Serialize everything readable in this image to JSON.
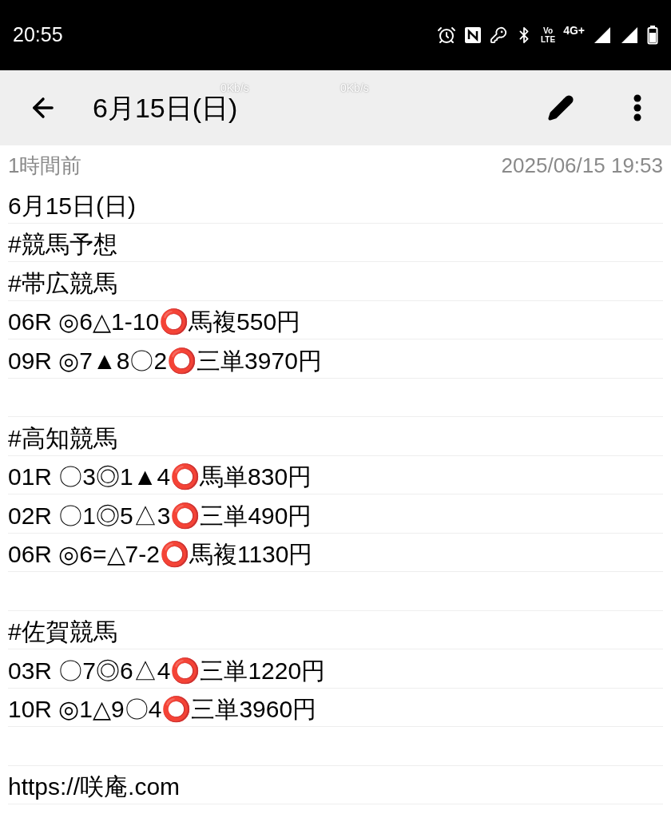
{
  "status_bar": {
    "time": "20:55",
    "volte": [
      "Vo",
      "LTE"
    ],
    "network": "4G+",
    "speeds": [
      "0Kb/s",
      "0Kb/s"
    ]
  },
  "toolbar": {
    "title": "6月15日(日)"
  },
  "meta": {
    "relative_time": "1時間前",
    "timestamp": "2025/06/15 19:53"
  },
  "lines": [
    {
      "kind": "text",
      "text": "6月15日(日)"
    },
    {
      "kind": "text",
      "text": "#競馬予想"
    },
    {
      "kind": "text",
      "text": "#帯広競馬"
    },
    {
      "kind": "text",
      "text": "06R ◎6△1-10⭕馬複550円"
    },
    {
      "kind": "text",
      "text": "09R ◎7▲8〇2⭕三単3970円"
    },
    {
      "kind": "blank"
    },
    {
      "kind": "text",
      "text": "#高知競馬"
    },
    {
      "kind": "text",
      "text": "01R 〇3◎1▲4⭕馬単830円"
    },
    {
      "kind": "text",
      "text": "02R 〇1◎5△3⭕三単490円"
    },
    {
      "kind": "text",
      "text": "06R ◎6=△7-2⭕馬複1130円"
    },
    {
      "kind": "blank"
    },
    {
      "kind": "text",
      "text": "#佐賀競馬"
    },
    {
      "kind": "text",
      "text": "03R 〇7◎6△4⭕三単1220円"
    },
    {
      "kind": "text",
      "text": "10R ◎1△9〇4⭕三単3960円"
    },
    {
      "kind": "blank"
    },
    {
      "kind": "text",
      "text": "https://咲庵.com"
    }
  ]
}
